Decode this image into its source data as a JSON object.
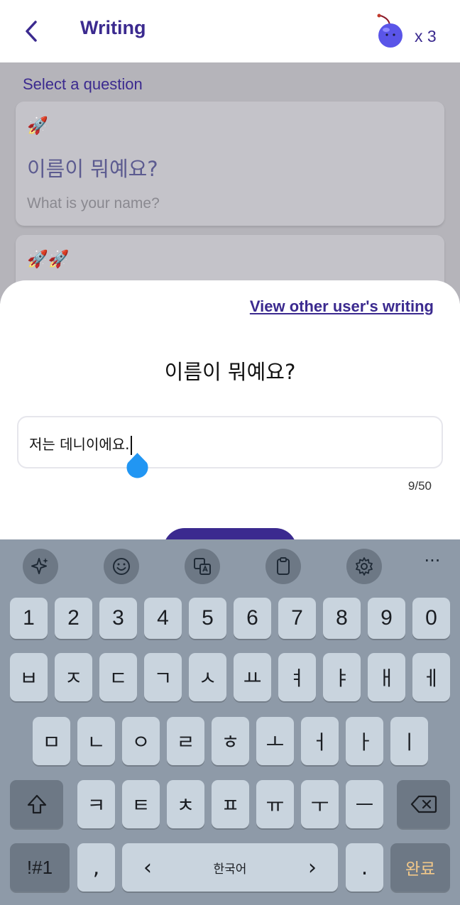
{
  "header": {
    "title": "Writing",
    "cherry_count": "x 3"
  },
  "content": {
    "select_label": "Select a question",
    "cards": [
      {
        "rockets": "🚀",
        "question_ko": "이름이 뭐예요?",
        "question_en": "What is your name?"
      },
      {
        "rockets": "🚀🚀"
      }
    ]
  },
  "sheet": {
    "other_link": "View other user's writing",
    "question": "이름이 뭐예요?",
    "answer": "저는 데니이에요.",
    "counter": "9/50"
  },
  "keyboard": {
    "tools": [
      "sparkle-icon",
      "emoji-icon",
      "translate-icon",
      "clipboard-icon",
      "settings-icon"
    ],
    "more": "···",
    "row_numbers": [
      "1",
      "2",
      "3",
      "4",
      "5",
      "6",
      "7",
      "8",
      "9",
      "0"
    ],
    "row1": [
      "ㅂ",
      "ㅈ",
      "ㄷ",
      "ㄱ",
      "ㅅ",
      "ㅛ",
      "ㅕ",
      "ㅑ",
      "ㅐ",
      "ㅔ"
    ],
    "row2": [
      "ㅁ",
      "ㄴ",
      "ㅇ",
      "ㄹ",
      "ㅎ",
      "ㅗ",
      "ㅓ",
      "ㅏ",
      "ㅣ"
    ],
    "row3": [
      "ㅋ",
      "ㅌ",
      "ㅊ",
      "ㅍ",
      "ㅠ",
      "ㅜ",
      "ㅡ"
    ],
    "symbols": "!#1",
    "comma": ",",
    "space_left": "‹",
    "space_label": "한국어",
    "space_right": "›",
    "period": ".",
    "done": "완료"
  },
  "colors": {
    "accent": "#3b2a8f",
    "keyboard_bg": "#8e9aa8",
    "key_bg": "#c9d4de",
    "drop": "#2196f3"
  }
}
